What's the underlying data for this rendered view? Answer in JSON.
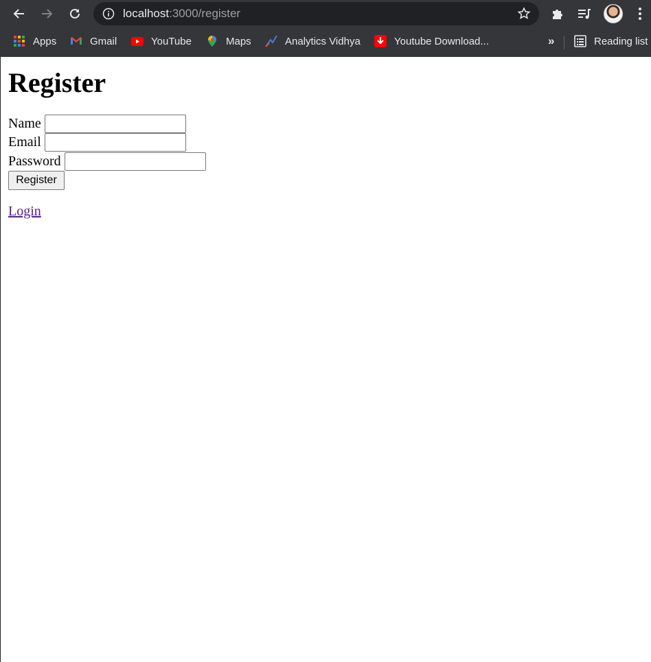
{
  "browser": {
    "url_host": "localhost",
    "url_path": ":3000/register",
    "bookmarks": [
      {
        "label": "Apps",
        "icon": "apps-grid-icon"
      },
      {
        "label": "Gmail",
        "icon": "gmail-icon"
      },
      {
        "label": "YouTube",
        "icon": "youtube-icon"
      },
      {
        "label": "Maps",
        "icon": "maps-icon"
      },
      {
        "label": "Analytics Vidhya",
        "icon": "analytics-vidhya-icon"
      },
      {
        "label": "Youtube Download...",
        "icon": "download-icon"
      }
    ],
    "overflow_label": "»",
    "reading_list_label": "Reading list"
  },
  "page": {
    "title": "Register",
    "fields": [
      {
        "label": "Name",
        "value": ""
      },
      {
        "label": "Email",
        "value": ""
      },
      {
        "label": "Password",
        "value": ""
      }
    ],
    "submit_label": "Register",
    "login_link": "Login"
  },
  "colors": {
    "chrome_bg": "#35363a",
    "omnibox_bg": "#202124",
    "link_visited": "#551a8b"
  }
}
